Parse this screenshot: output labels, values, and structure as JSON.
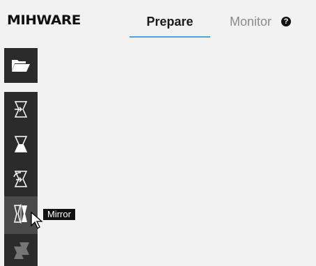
{
  "brand": {
    "logo_text": "MIHWARE"
  },
  "tabs": [
    {
      "label": "Prepare",
      "active": true
    },
    {
      "label": "Monitor",
      "active": false
    }
  ],
  "help_icon": "?",
  "toolbar": {
    "open_icon": "folder-open-icon",
    "tools": [
      {
        "name": "import-tool",
        "icon": "hourglass-arrow-icon"
      },
      {
        "name": "fill-tool",
        "icon": "hourglass-fill-icon"
      },
      {
        "name": "rotate-tool",
        "icon": "hourglass-rotate-icon"
      },
      {
        "name": "mirror-tool",
        "icon": "hourglass-mirror-icon",
        "active": true
      },
      {
        "name": "stack-tool",
        "icon": "hourglass-stack-icon",
        "disabled": true
      }
    ]
  },
  "tooltip": {
    "text": "Mirror"
  },
  "colors": {
    "accent": "#4fa3d8",
    "toolbar_bg": "#2b2b2b",
    "active_tool": "#4a4a4a"
  }
}
